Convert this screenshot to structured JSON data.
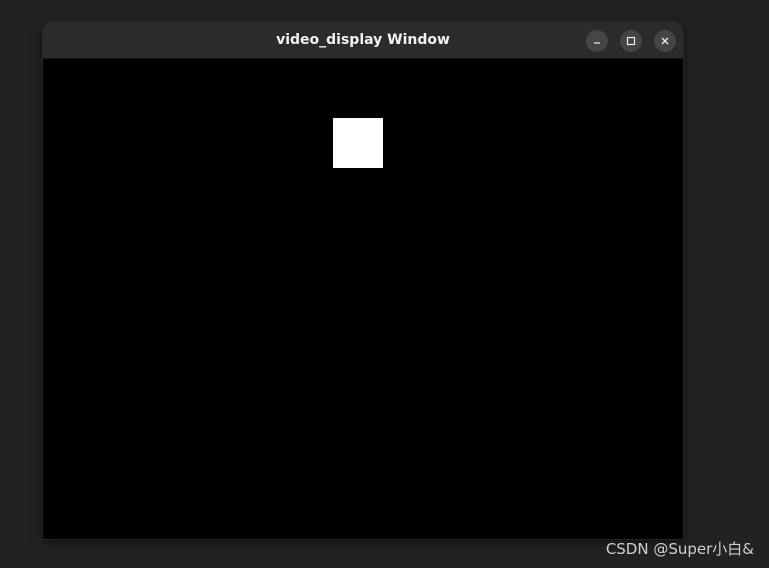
{
  "window": {
    "title": "video_display Window",
    "controls": {
      "minimize_icon": "minimize-icon",
      "maximize_icon": "maximize-icon",
      "close_icon": "close-icon"
    }
  },
  "content": {
    "background": "#000000",
    "square_color": "#ffffff"
  },
  "watermark": {
    "text": "CSDN @Super小白&"
  }
}
